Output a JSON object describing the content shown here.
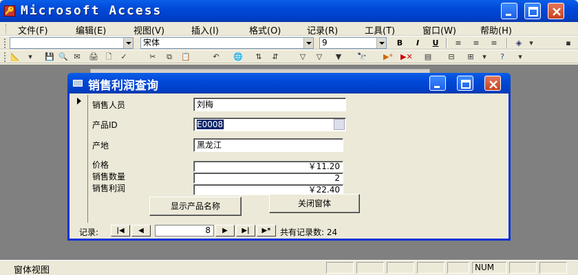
{
  "app": {
    "title": "Microsoft Access"
  },
  "menu": [
    {
      "label": "文件(F)"
    },
    {
      "label": "编辑(E)"
    },
    {
      "label": "视图(V)"
    },
    {
      "label": "插入(I)"
    },
    {
      "label": "格式(O)"
    },
    {
      "label": "记录(R)"
    },
    {
      "label": "工具(T)"
    },
    {
      "label": "窗口(W)"
    },
    {
      "label": "帮助(H)"
    }
  ],
  "format_toolbar": {
    "object_combo": "",
    "font_name": "宋体",
    "font_size": "9",
    "bold": "B",
    "italic": "I",
    "underline": "U"
  },
  "form": {
    "title": "销售利润查询",
    "fields": {
      "salesperson": {
        "label": "销售人员",
        "value": "刘梅"
      },
      "product_id": {
        "label": "产品ID",
        "value": "E0008"
      },
      "origin": {
        "label": "产地",
        "value": "黑龙江"
      },
      "price": {
        "label": "价格",
        "value": "￥11.20"
      },
      "quantity": {
        "label": "销售数量",
        "value": "2"
      },
      "profit": {
        "label": "销售利润",
        "value": "￥22.40"
      }
    },
    "buttons": {
      "show_name": "显示产品名称",
      "close": "关闭窗体"
    },
    "nav": {
      "label": "记录:",
      "current": "8",
      "total_text": "共有记录数: 24"
    }
  },
  "status": {
    "view": "窗体视图",
    "num": "NUM"
  },
  "icons": [
    "access-logo-icon",
    "minimize-icon",
    "maximize-icon",
    "close-icon",
    "form-icon"
  ],
  "colors": {
    "titlebar": "#0049d8",
    "close_button": "#c8411b",
    "face": "#ece9d8",
    "mdi_background": "#808080"
  }
}
